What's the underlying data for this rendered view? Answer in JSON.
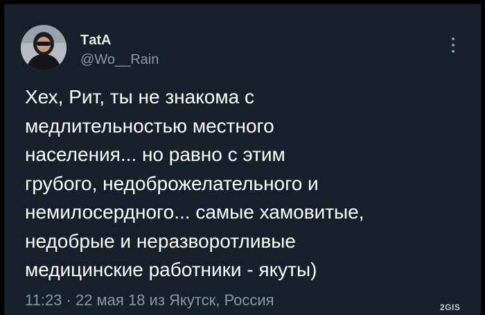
{
  "tweet": {
    "author": {
      "display_name": "ТatA",
      "handle": "@Wo__Rain"
    },
    "menu": {
      "icon": "more-vertical-icon"
    },
    "text_lines": [
      "Хех, Рит, ты не знакома с",
      "медлительностью местного",
      "населения... но равно с этим",
      "грубого, недоброжелательного и",
      "немилосердного... самые хамовитые,",
      "недобрые и неразворотливые",
      "медицинские работники - якуты)"
    ],
    "meta": "11:23 · 22 мая 18 из Якутск, Россия"
  },
  "watermark": "2GIS",
  "colors": {
    "background": "#15202b",
    "primary_text": "#ffffff",
    "secondary_text": "#8b98a5"
  }
}
